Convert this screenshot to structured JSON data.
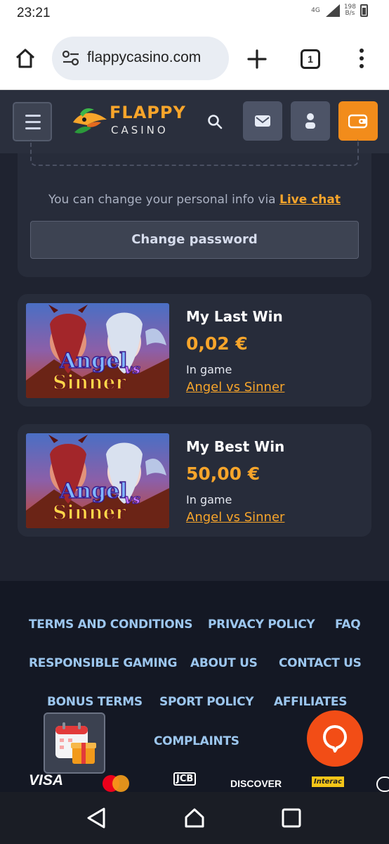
{
  "status_bar": {
    "time": "23:21",
    "network": "4G",
    "speed_value": "198",
    "speed_unit": "B/s"
  },
  "browser": {
    "url": "flappycasino.com",
    "tab_count": "1",
    "icons": [
      "home-icon",
      "site-settings-icon",
      "new-tab-icon",
      "tab-switcher-icon",
      "overflow-menu-icon"
    ]
  },
  "header": {
    "logo_top": "FLAPPY",
    "logo_bottom": "CASINO",
    "icons": [
      "menu-icon",
      "search-icon",
      "mail-icon",
      "user-icon",
      "wallet-icon"
    ],
    "colors": {
      "header_bg": "#2a2f3d",
      "accent": "#f7a52b",
      "wallet_bg": "#f28c1b"
    }
  },
  "profile": {
    "info_text": "You can change your personal info via",
    "live_chat_label": "Live chat",
    "change_password_label": "Change password"
  },
  "wins": [
    {
      "title": "My Last Win",
      "amount": "0,02 €",
      "in_game_label": "In game",
      "game_name": "Angel vs Sinner",
      "thumb_text_1": "Angel",
      "thumb_text_vs": "vs",
      "thumb_text_2": "Sinner"
    },
    {
      "title": "My Best Win",
      "amount": "50,00 €",
      "in_game_label": "In game",
      "game_name": "Angel vs Sinner",
      "thumb_text_1": "Angel",
      "thumb_text_vs": "vs",
      "thumb_text_2": "Sinner"
    }
  ],
  "footer": {
    "links": [
      "TERMS AND CONDITIONS",
      "PRIVACY POLICY",
      "FAQ",
      "RESPONSIBLE GAMING",
      "ABOUT US",
      "CONTACT US",
      "BONUS TERMS",
      "SPORT POLICY",
      "AFFILIATES",
      "COMPLAINTS"
    ],
    "payments": [
      "VISA",
      "mastercard",
      "JCB",
      "DISCOVER",
      "Interac",
      "diners"
    ],
    "colors": {
      "link": "#9cc6ee",
      "chat_button": "#f24d16"
    }
  },
  "nav_bar": {
    "icons": [
      "back-icon",
      "home-nav-icon",
      "recents-icon"
    ]
  }
}
